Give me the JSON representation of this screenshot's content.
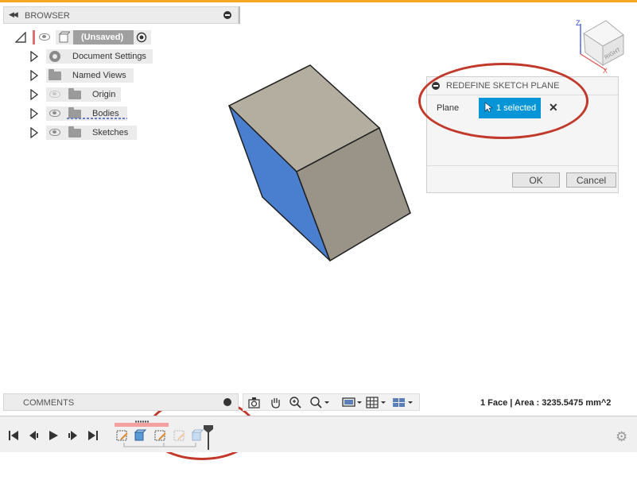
{
  "browser": {
    "title": "BROWSER",
    "root_label": "(Unsaved)",
    "items": [
      {
        "label": "Document Settings",
        "icon": "gear-icon"
      },
      {
        "label": "Named Views",
        "icon": "folder-icon"
      },
      {
        "label": "Origin",
        "icon": "folder-icon",
        "visible": false
      },
      {
        "label": "Bodies",
        "icon": "folder-icon",
        "visible": true
      },
      {
        "label": "Sketches",
        "icon": "folder-icon",
        "visible": true
      }
    ]
  },
  "viewcube": {
    "face_label": "RIGHT",
    "axis_z": "Z",
    "axis_x": "X"
  },
  "dialog": {
    "title": "REDEFINE SKETCH PLANE",
    "plane_label": "Plane",
    "selection_text": "1 selected",
    "clear_glyph": "✕",
    "ok_label": "OK",
    "cancel_label": "Cancel"
  },
  "comments": {
    "title": "COMMENTS"
  },
  "status_bar": {
    "selection_info": "1 Face | Area : 3235.5475 mm^2"
  },
  "colors": {
    "accent": "#0696d7",
    "annotation": "#c0392b",
    "top_stripe": "#f5a623",
    "selected_face": "#4a7fcf"
  }
}
